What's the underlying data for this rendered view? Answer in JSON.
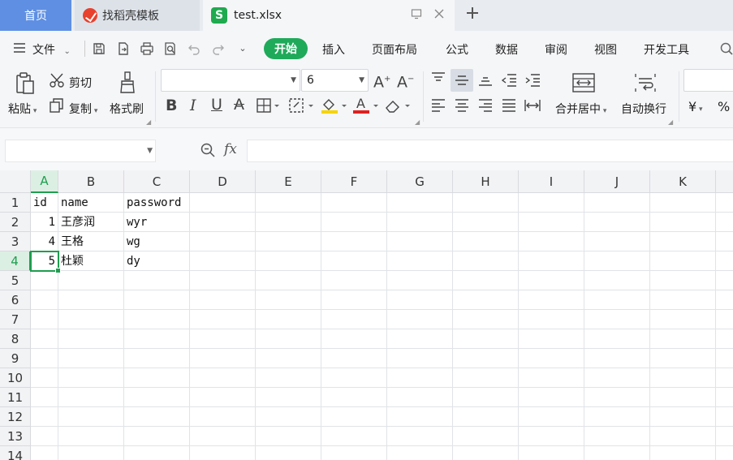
{
  "tabs": {
    "home": "首页",
    "docer": "找稻壳模板",
    "file": "test.xlsx"
  },
  "menu": {
    "file": "文件",
    "start": "开始",
    "items": [
      "插入",
      "页面布局",
      "公式",
      "数据",
      "审阅",
      "视图",
      "开发工具"
    ]
  },
  "ribbon": {
    "paste": "粘贴",
    "cut": "剪切",
    "copy": "复制",
    "format_painter": "格式刷",
    "font_name": "",
    "font_size": "6",
    "merge_center": "合并居中",
    "wrap_text": "自动换行",
    "currency": "¥"
  },
  "formula": {
    "namebox": "",
    "fx": "fx",
    "content": ""
  },
  "grid": {
    "columns": [
      "A",
      "B",
      "C",
      "D",
      "E",
      "F",
      "G",
      "H",
      "I",
      "J",
      "K"
    ],
    "rows": [
      "1",
      "2",
      "3",
      "4",
      "5",
      "6",
      "7",
      "8",
      "9",
      "10",
      "11",
      "12",
      "13",
      "14"
    ],
    "selected_column": "A",
    "selected_row": "4",
    "cells": [
      [
        "id",
        "name",
        "password"
      ],
      [
        "1",
        "王彦润",
        "wyr"
      ],
      [
        "4",
        "王格",
        "wg"
      ],
      [
        "5",
        "杜颖",
        "dy"
      ]
    ]
  },
  "colors": {
    "accent_green": "#1faa5a",
    "home_tab_blue": "#5e8fe3",
    "selection_green": "#1e9e4f"
  }
}
